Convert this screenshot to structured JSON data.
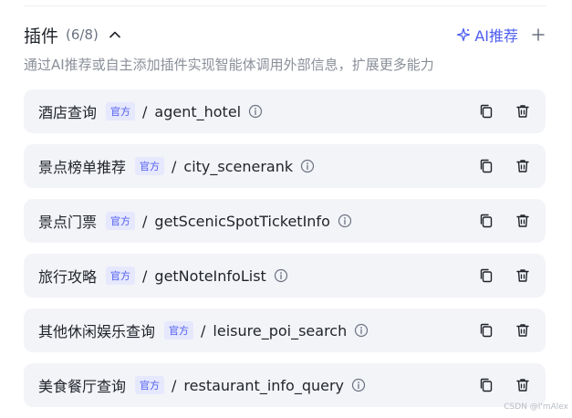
{
  "header": {
    "title": "插件",
    "count": "(6/8)",
    "ai_label": "AI推荐",
    "collapse_icon": "chevron-up-icon",
    "add_icon": "plus-icon"
  },
  "description": "通过AI推荐或自主添加插件实现智能体调用外部信息，扩展更多能力",
  "plugins": [
    {
      "name": "酒店查询",
      "badge": "官方",
      "separator": "/",
      "api": "agent_hotel"
    },
    {
      "name": "景点榜单推荐",
      "badge": "官方",
      "separator": "/",
      "api": "city_scenerank"
    },
    {
      "name": "景点门票",
      "badge": "官方",
      "separator": "/",
      "api": "getScenicSpotTicketInfo"
    },
    {
      "name": "旅行攻略",
      "badge": "官方",
      "separator": "/",
      "api": "getNoteInfoList"
    },
    {
      "name": "其他休闲娱乐查询",
      "badge": "官方",
      "separator": "/",
      "api": "leisure_poi_search"
    },
    {
      "name": "美食餐厅查询",
      "badge": "官方",
      "separator": "/",
      "api": "restaurant_info_query"
    }
  ],
  "watermark": "CSDN @I'mAlex",
  "colors": {
    "accent": "#4e5cf0",
    "card_bg": "#f3f4f8",
    "badge_bg": "#e6e8fd"
  }
}
